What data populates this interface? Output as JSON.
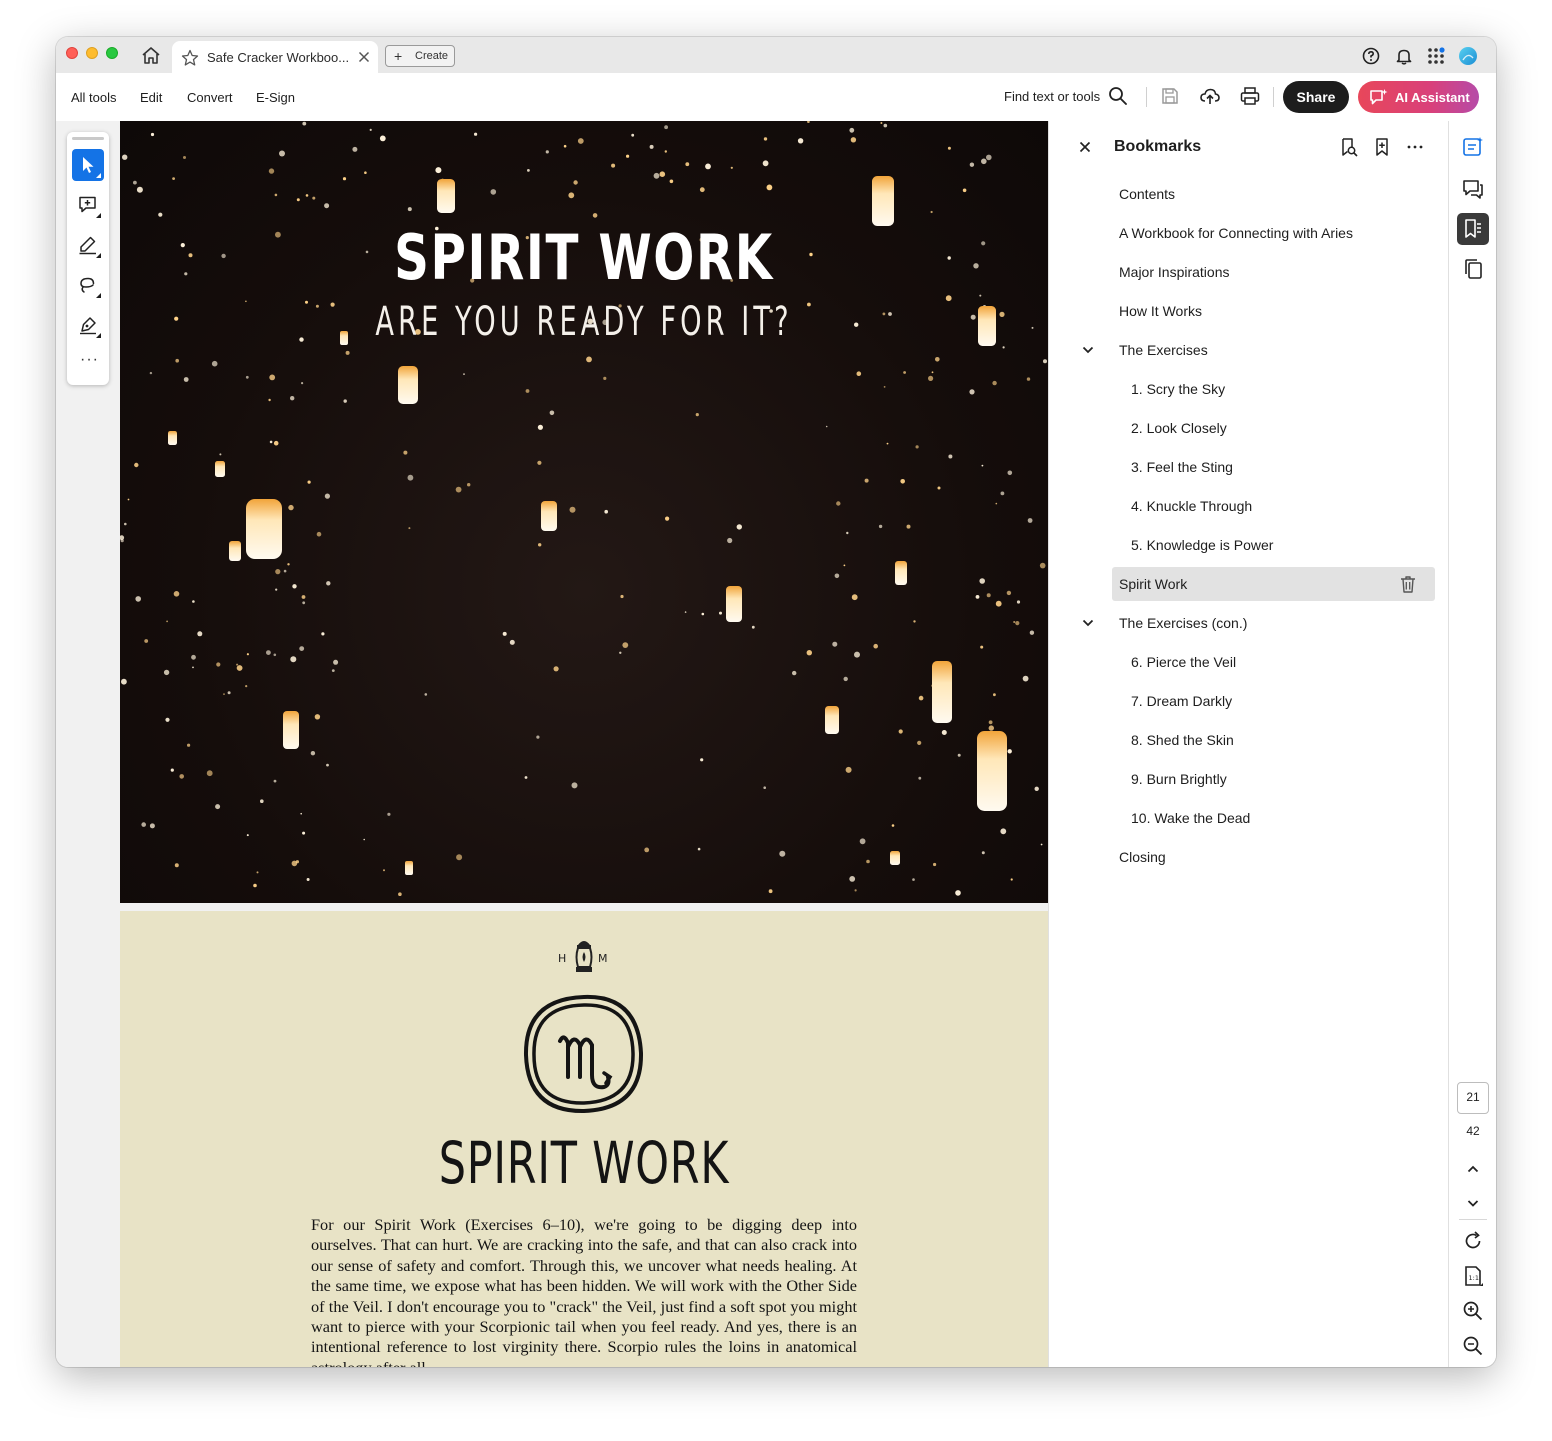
{
  "window": {
    "tab_title": "Safe Cracker Workboo...",
    "create_label": "Create"
  },
  "toolbar": {
    "menu": [
      "All tools",
      "Edit",
      "Convert",
      "E-Sign"
    ],
    "find_placeholder": "Find text or tools",
    "share_label": "Share",
    "ai_label": "AI Assistant"
  },
  "colors": {
    "accent_blue": "#1473e6",
    "share_bg": "#1d1d1d",
    "ai_gradient_start": "#e8475a",
    "ai_gradient_end": "#b64ba8",
    "page2_bg": "#e8e3c6"
  },
  "left_tools": [
    "select-tool-icon",
    "add-comment-icon",
    "highlight-pen-icon",
    "draw-lasso-icon",
    "sign-pen-icon",
    "more-tools-icon"
  ],
  "document": {
    "page1": {
      "title": "SPIRIT WORK",
      "subtitle": "ARE YOU READY FOR IT?"
    },
    "page2": {
      "logo_left": "H",
      "logo_right": "M",
      "title": "SPIRIT WORK",
      "body": "For our Spirit Work (Exercises 6–10), we're going to be digging deep into ourselves. That can hurt. We are cracking into the safe, and that can also crack into our sense of safety and comfort. Through this, we uncover what needs healing. At the same time, we expose what has been hidden. We will work with the Other Side of the Veil. I don't encourage you to \"crack\" the Veil, just find a soft spot you might want to pierce with your Scorpionic tail when you feel ready. And yes, there is an intentional reference to lost virginity there. Scorpio rules the loins in anatomical astrology after all."
    }
  },
  "bookmarks": {
    "title": "Bookmarks",
    "items": [
      {
        "label": "Contents",
        "level": 0
      },
      {
        "label": "A Workbook for Connecting with Aries",
        "level": 0
      },
      {
        "label": "Major Inspirations",
        "level": 0
      },
      {
        "label": "How It Works",
        "level": 0
      },
      {
        "label": "The Exercises",
        "level": 0,
        "expanded": true
      },
      {
        "label": "1. Scry the Sky",
        "level": 1
      },
      {
        "label": "2. Look Closely",
        "level": 1
      },
      {
        "label": "3. Feel the Sting",
        "level": 1
      },
      {
        "label": "4. Knuckle Through",
        "level": 1
      },
      {
        "label": "5. Knowledge is Power",
        "level": 1
      },
      {
        "label": "Spirit Work",
        "level": 0,
        "selected": true
      },
      {
        "label": "The Exercises (con.)",
        "level": 0,
        "expanded": true
      },
      {
        "label": "6. Pierce the Veil",
        "level": 1
      },
      {
        "label": "7. Dream Darkly",
        "level": 1
      },
      {
        "label": "8. Shed the Skin",
        "level": 1
      },
      {
        "label": "9. Burn Brightly",
        "level": 1
      },
      {
        "label": "10. Wake the Dead",
        "level": 1
      },
      {
        "label": "Closing",
        "level": 0
      }
    ]
  },
  "navigation": {
    "current_page": "21",
    "total_pages": "42"
  }
}
